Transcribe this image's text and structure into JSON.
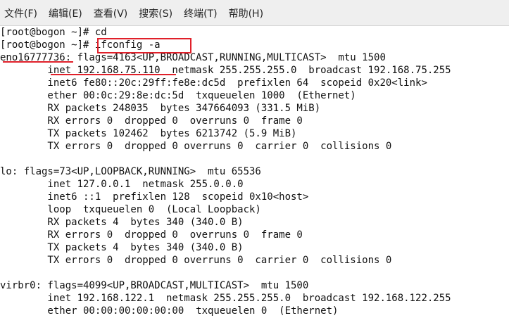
{
  "menu": {
    "items": [
      "文件(F)",
      "编辑(E)",
      "查看(V)",
      "搜索(S)",
      "终端(T)",
      "帮助(H)"
    ]
  },
  "terminal": {
    "lines": [
      "[root@bogon ~]# cd",
      "[root@bogon ~]# ifconfig -a",
      "eno16777736: flags=4163<UP,BROADCAST,RUNNING,MULTICAST>  mtu 1500",
      "        inet 192.168.75.110  netmask 255.255.255.0  broadcast 192.168.75.255",
      "        inet6 fe80::20c:29ff:fe8e:dc5d  prefixlen 64  scopeid 0x20<link>",
      "        ether 00:0c:29:8e:dc:5d  txqueuelen 1000  (Ethernet)",
      "        RX packets 248035  bytes 347664093 (331.5 MiB)",
      "        RX errors 0  dropped 0  overruns 0  frame 0",
      "        TX packets 102462  bytes 6213742 (5.9 MiB)",
      "        TX errors 0  dropped 0 overruns 0  carrier 0  collisions 0",
      "",
      "lo: flags=73<UP,LOOPBACK,RUNNING>  mtu 65536",
      "        inet 127.0.0.1  netmask 255.0.0.0",
      "        inet6 ::1  prefixlen 128  scopeid 0x10<host>",
      "        loop  txqueuelen 0  (Local Loopback)",
      "        RX packets 4  bytes 340 (340.0 B)",
      "        RX errors 0  dropped 0  overruns 0  frame 0",
      "        TX packets 4  bytes 340 (340.0 B)",
      "        TX errors 0  dropped 0 overruns 0  carrier 0  collisions 0",
      "",
      "virbr0: flags=4099<UP,BROADCAST,MULTICAST>  mtu 1500",
      "        inet 192.168.122.1  netmask 255.255.255.0  broadcast 192.168.122.255",
      "        ether 00:00:00:00:00:00  txqueuelen 0  (Ethernet)"
    ]
  },
  "annotations": {
    "color": "#e0202a"
  }
}
